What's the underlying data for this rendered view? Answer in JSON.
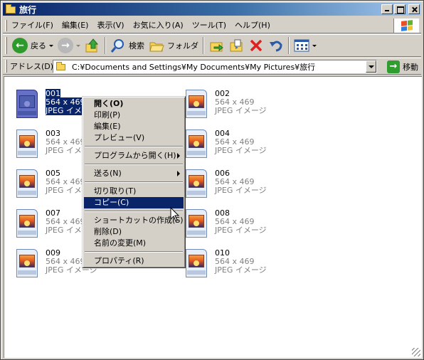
{
  "window": {
    "title": "旅行"
  },
  "menubar": {
    "items": [
      "ファイル(F)",
      "編集(E)",
      "表示(V)",
      "お気に入り(A)",
      "ツール(T)",
      "ヘルプ(H)"
    ]
  },
  "toolbar": {
    "back_label": "戻る",
    "search_label": "検索",
    "folders_label": "フォルダ"
  },
  "addressbar": {
    "label": "アドレス(D)",
    "path": "C:¥Documents and Settings¥My Documents¥My Pictures¥旅行",
    "go_label": "移動"
  },
  "files": [
    {
      "name": "001",
      "dimensions": "564 x 469",
      "type": "JPEG イメージ",
      "selected": true
    },
    {
      "name": "002",
      "dimensions": "564 x 469",
      "type": "JPEG イメージ"
    },
    {
      "name": "003",
      "dimensions": "564 x 469",
      "type": "JPEG イメージ"
    },
    {
      "name": "004",
      "dimensions": "564 x 469",
      "type": "JPEG イメージ"
    },
    {
      "name": "005",
      "dimensions": "564 x 469",
      "type": "JPEG イメージ"
    },
    {
      "name": "006",
      "dimensions": "564 x 469",
      "type": "JPEG イメージ"
    },
    {
      "name": "007",
      "dimensions": "564 x 469",
      "type": "JPEG イメージ"
    },
    {
      "name": "008",
      "dimensions": "564 x 469",
      "type": "JPEG イメージ"
    },
    {
      "name": "009",
      "dimensions": "564 x 469",
      "type": "JPEG イメージ"
    },
    {
      "name": "010",
      "dimensions": "564 x 469",
      "type": "JPEG イメージ"
    }
  ],
  "context_menu": {
    "open": "開く(O)",
    "print": "印刷(P)",
    "edit": "編集(E)",
    "preview": "プレビュー(V)",
    "open_with": "プログラムから開く(H)",
    "send_to": "送る(N)",
    "cut": "切り取り(T)",
    "copy": "コピー(C)",
    "create_shortcut": "ショートカットの作成(S)",
    "delete": "削除(D)",
    "rename": "名前の変更(M)",
    "properties": "プロパティ(R)"
  },
  "colors": {
    "title_gradient_start": "#0a246a",
    "title_gradient_end": "#a6caf0",
    "selection": "#0a246a",
    "chrome": "#d4d0c8"
  }
}
